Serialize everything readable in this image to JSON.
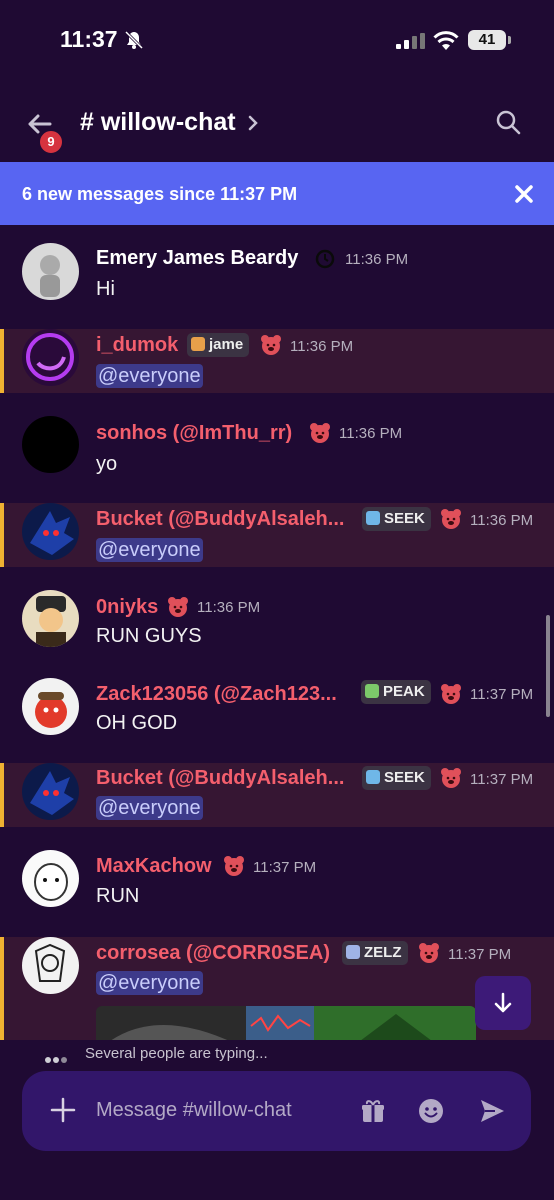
{
  "status": {
    "time": "11:37",
    "battery": "41"
  },
  "header": {
    "channel": "# willow-chat",
    "unread_badge": "9"
  },
  "banner": {
    "text": "6 new messages since 11:37 PM"
  },
  "messages": [
    {
      "author": "Emery James Beardy",
      "time": "11:36 PM",
      "text": "Hi"
    },
    {
      "author": "i_dumok",
      "tag": "jame",
      "time": "11:36 PM",
      "text": "@everyone"
    },
    {
      "author": "sonhos (@ImThu_rr)",
      "time": "11:36 PM",
      "text": "yo"
    },
    {
      "author": "Bucket (@BuddyAlsaleh...",
      "tag": "SEEK",
      "time": "11:36 PM",
      "text": "@everyone"
    },
    {
      "author": "0niyks",
      "time": "11:36 PM",
      "text": "RUN GUYS"
    },
    {
      "author": "Zack123056 (@Zach123...",
      "tag": "PEAK",
      "time": "11:37 PM",
      "text": "OH GOD"
    },
    {
      "author": "Bucket (@BuddyAlsaleh...",
      "tag": "SEEK",
      "time": "11:37 PM",
      "text": "@everyone"
    },
    {
      "author": "MaxKachow",
      "time": "11:37 PM",
      "text": "RUN"
    },
    {
      "author": "corrosea (@CORR0SEA)",
      "tag": "ZELZ",
      "time": "11:37 PM",
      "text": "@everyone"
    }
  ],
  "typing": {
    "text": "Several people are typing..."
  },
  "composer": {
    "placeholder": "Message #willow-chat"
  },
  "colors": {
    "background": "#1f0a33",
    "banner": "#5865f2",
    "name": "#f45f6d",
    "highlight": "#361633",
    "highlight_bar": "#f0b232",
    "composer": "#32166a"
  }
}
